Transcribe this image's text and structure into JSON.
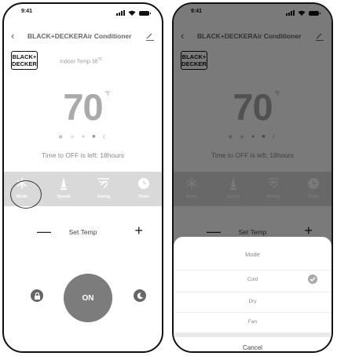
{
  "status": {
    "time": "9:41"
  },
  "header": {
    "title": "BLACK+DECKERAir Conditioner"
  },
  "brand": {
    "line1": "BLACK+",
    "line2": "DECKER"
  },
  "indoor": {
    "label": "Indoor Temp 38",
    "unit": "℃"
  },
  "temperature": {
    "value": "70",
    "unit": "℉"
  },
  "off_text": "Time to OFF is left: 18hours",
  "functions": [
    "Mode",
    "Speed",
    "Swing",
    "Timer"
  ],
  "set_temp": {
    "minus": "—",
    "label": "Set Temp",
    "plus": "+"
  },
  "power_label": "ON",
  "sheet": {
    "title": "Mode",
    "options": [
      "Cold",
      "Dry",
      "Fan"
    ],
    "selected": "Cold",
    "cancel": "Cancel"
  },
  "colors": {
    "power_button": "#7c7c7c",
    "function_bar": "#d9d9d9",
    "temperature": "#aaaaaa"
  }
}
